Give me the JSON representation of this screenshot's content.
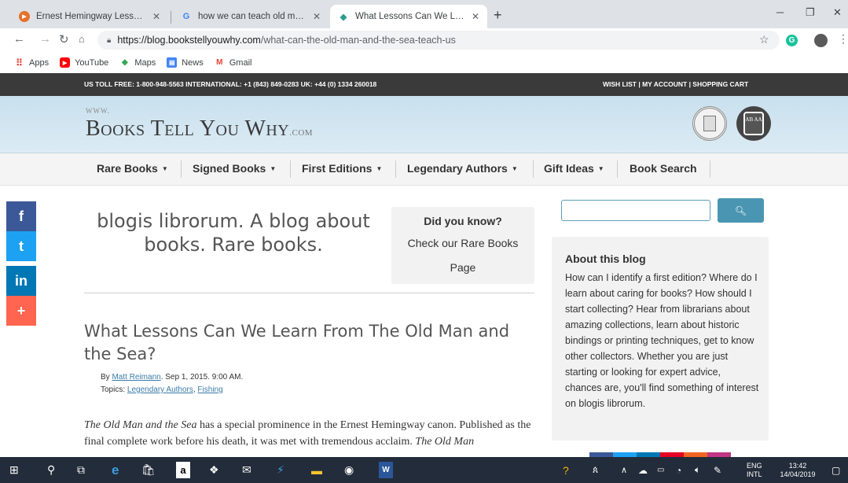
{
  "browser": {
    "tabs": [
      {
        "title": "Ernest Hemingway Lesson Plan |",
        "icon": "youtube-icon"
      },
      {
        "title": "how we can teach old man and t",
        "icon": "google-icon"
      },
      {
        "title": "What Lessons Can We Learn Fro",
        "icon": "books-tell-you-why-icon"
      }
    ],
    "url_host": "https://blog.bookstellyouwhy.com",
    "url_path": "/what-can-the-old-man-and-the-sea-teach-us",
    "bookmarks": [
      "Apps",
      "YouTube",
      "Maps",
      "News",
      "Gmail"
    ]
  },
  "site": {
    "topbar_left": "US TOLL FREE: 1-800-948-5563  INTERNATIONAL: +1 (843) 849-0283  UK: +44 (0) 1334 260018",
    "topbar_right": "WISH LIST | MY ACCOUNT | SHOPPING CART",
    "logo_www": "WWW.",
    "logo_text": "Books Tell You Why",
    "logo_com": ".COM",
    "seal_text": "AB AA",
    "menu": [
      {
        "label": "Rare Books",
        "caret": "▼"
      },
      {
        "label": "Signed Books",
        "caret": "▼"
      },
      {
        "label": "First Editions",
        "caret": "▼"
      },
      {
        "label": "Legendary Authors",
        "caret": "▼"
      },
      {
        "label": "Gift Ideas",
        "caret": "▼"
      },
      {
        "label": "Book Search",
        "caret": ""
      }
    ]
  },
  "social": {
    "facebook": "f",
    "twitter": "t",
    "linkedin": "in",
    "more": "+"
  },
  "blog": {
    "tagline": "blogis librorum. A blog about books. Rare books.",
    "did_you_know_title": "Did you know?",
    "did_you_know_text": "Check our Rare Books Page"
  },
  "post": {
    "title": "What Lessons Can We Learn From The Old Man and the Sea?",
    "by": "By ",
    "author": "Matt Reimann",
    "date": ". Sep 1, 2015. 9:00 AM.",
    "topics_label": "Topics: ",
    "topic1": "Legendary Authors",
    "topic_sep": ", ",
    "topic2": "Fishing",
    "book_title": "The Old Man and the Sea",
    "body_1": " has a special prominence in the Ernest Hemingway canon. Published as the final complete work before his death, it was met with tremendous acclaim. ",
    "body_2": "The Old Man"
  },
  "sidebar": {
    "search_placeholder": "",
    "about_title": "About this blog",
    "about_text": "How can I identify a first edition? Where do I learn about caring for books? How should I start collecting? Hear from librarians about amazing collections, learn about historic bindings or printing techniques, get to know other collectors. Whether you are just starting or looking for expert advice, chances are, you'll find something of interest on blogis librorum."
  },
  "taskbar": {
    "lang1": "ENG",
    "lang2": "INTL",
    "time": "13:42",
    "date": "14/04/2019"
  }
}
